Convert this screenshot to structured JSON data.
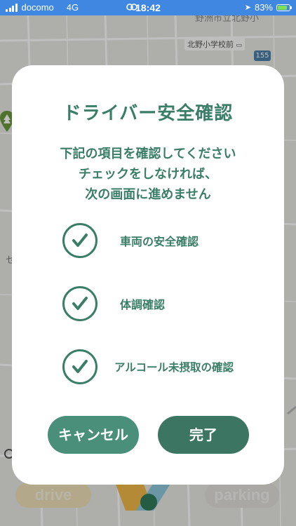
{
  "status_bar": {
    "carrier": "docomo",
    "network": "4G",
    "time": "18:42",
    "battery_percent_label": "83%",
    "battery_level": 0.83,
    "background_color": "#3f87e0"
  },
  "map": {
    "top_label": "野洲市立北野小",
    "place_label": "北野小学校前",
    "route_number": "155",
    "edge_glyph": "セ"
  },
  "modal": {
    "title": "ドライバー安全確認",
    "instructions": [
      "下記の項目を確認してください",
      "チェックをしなければ、",
      "次の画面に進めません"
    ],
    "checklist": [
      {
        "label": "車両の安全確認",
        "checked": true,
        "icon": "checkmark-icon"
      },
      {
        "label": "体調確認",
        "checked": true,
        "icon": "checkmark-icon"
      },
      {
        "label": "アルコール未摂取の確認",
        "checked": true,
        "icon": "checkmark-icon"
      }
    ],
    "cancel_label": "キャンセル",
    "done_label": "完了",
    "accent_color": "#3a7d68"
  },
  "bottom_nav": {
    "drive_label": "drive",
    "parking_label": "parking"
  }
}
